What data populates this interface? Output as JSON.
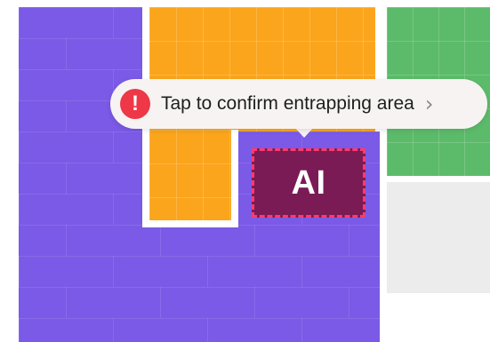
{
  "tooltip": {
    "message": "Tap to confirm entrapping area",
    "alert_glyph": "!",
    "alert_icon": "exclamation-circle-icon",
    "chevron_glyph": "›",
    "chevron_icon": "chevron-right-icon"
  },
  "board": {
    "selected_block_label": "AI",
    "colors": {
      "purple": "#7a5ae6",
      "orange": "#fba51c",
      "green": "#5cbb6a",
      "neutral": "#ececec",
      "ai_block": "#7a1b56",
      "selection_border": "#ff3b6b",
      "alert": "#ee3747"
    }
  }
}
